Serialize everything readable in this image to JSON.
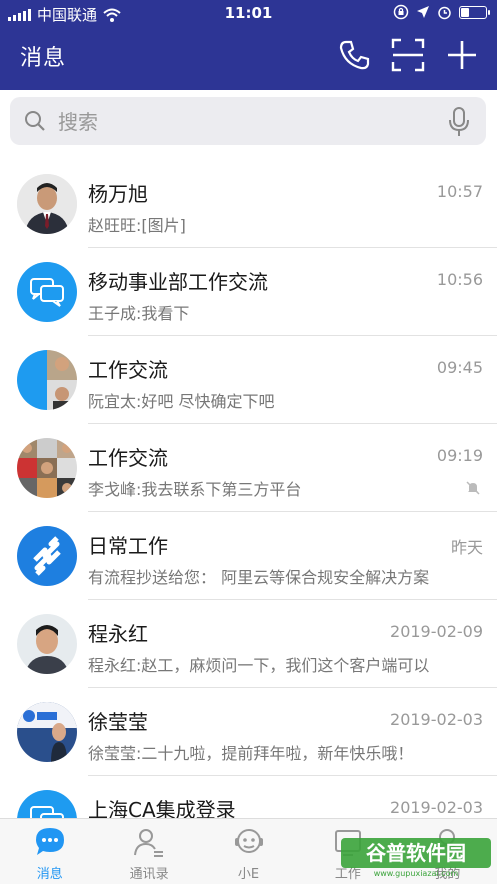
{
  "status": {
    "carrier": "中国联通",
    "time": "11:01"
  },
  "header": {
    "title": "消息"
  },
  "search": {
    "placeholder": "搜索"
  },
  "conversations": [
    {
      "name": "杨万旭",
      "preview": "赵旺旺:[图片]",
      "time": "10:57",
      "avatar": "photo-person"
    },
    {
      "name": "移动事业部工作交流",
      "preview": "王子成:我看下",
      "time": "10:56",
      "avatar": "chat-bubbles-icon"
    },
    {
      "name": "工作交流",
      "preview": "阮宜太:好吧 尽快确定下吧",
      "time": "09:45",
      "avatar": "group-avatar"
    },
    {
      "name": "工作交流",
      "preview": "李戈峰:我去联系下第三方平台",
      "time": "09:19",
      "avatar": "group-avatar",
      "muted": true
    },
    {
      "name": "日常工作",
      "preview": "有流程抄送给您：  阿里云等保合规安全解决方案",
      "time": "昨天",
      "avatar": "workflow-icon"
    },
    {
      "name": "程永红",
      "preview": "程永红:赵工，麻烦问一下，我们这个客户端可以",
      "time": "2019-02-09",
      "avatar": "photo-person"
    },
    {
      "name": "徐莹莹",
      "preview": "徐莹莹:二十九啦，提前拜年啦，新年快乐哦！",
      "time": "2019-02-03",
      "avatar": "photo-person"
    },
    {
      "name": "上海CA集成登录",
      "preview": "",
      "time": "2019-02-03",
      "avatar": "chat-bubbles-icon"
    }
  ],
  "tabs": [
    {
      "label": "消息",
      "icon": "message-icon",
      "active": true
    },
    {
      "label": "通讯录",
      "icon": "contacts-icon",
      "active": false
    },
    {
      "label": "小E",
      "icon": "assistant-icon",
      "active": false
    },
    {
      "label": "工作",
      "icon": "work-icon",
      "active": false
    },
    {
      "label": "我的",
      "icon": "profile-icon",
      "active": false
    }
  ],
  "watermark": {
    "text": "谷普软件园",
    "url": "www.gupuxiazai.com"
  },
  "colors": {
    "header": "#2d3595",
    "accent": "#2196f3"
  }
}
